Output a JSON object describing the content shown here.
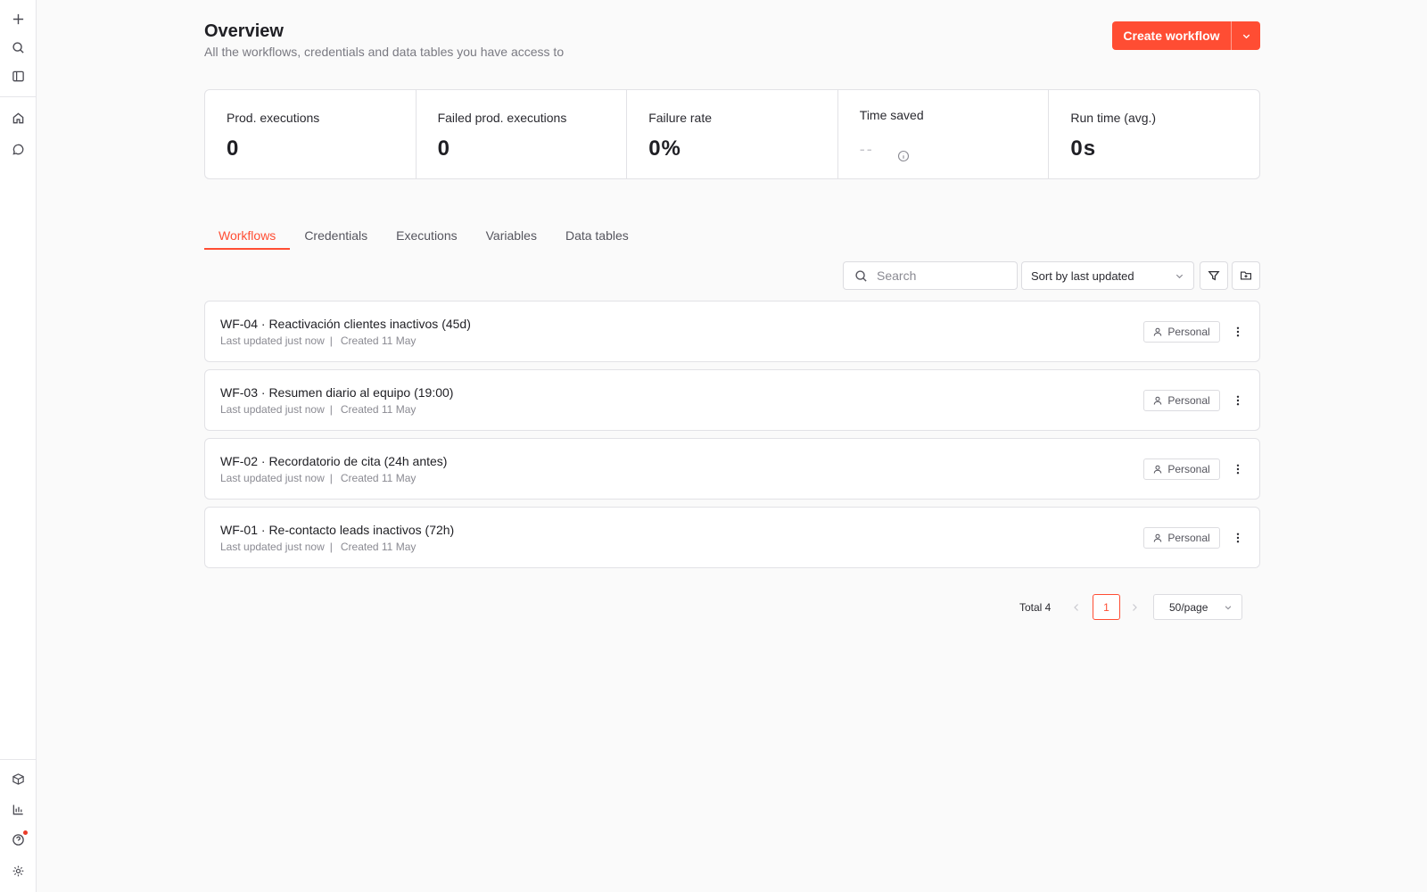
{
  "header": {
    "title": "Overview",
    "subtitle": "All the workflows, credentials and data tables you have access to",
    "create_label": "Create workflow"
  },
  "sidebar": {
    "top_icons": [
      "plus-icon",
      "search-icon",
      "panel-toggle-icon"
    ],
    "nav_icons": [
      "home-icon",
      "chat-icon"
    ],
    "bottom_icons": [
      "cube-icon",
      "chart-icon",
      "help-icon",
      "settings-icon"
    ]
  },
  "stats": [
    {
      "label": "Prod. executions",
      "value": "0"
    },
    {
      "label": "Failed prod. executions",
      "value": "0"
    },
    {
      "label": "Failure rate",
      "value": "0%"
    },
    {
      "label": "Time saved",
      "value": "--"
    },
    {
      "label": "Run time (avg.)",
      "value": "0s"
    }
  ],
  "tabs": [
    "Workflows",
    "Credentials",
    "Executions",
    "Variables",
    "Data tables"
  ],
  "active_tab": "Workflows",
  "toolbar": {
    "search_placeholder": "Search",
    "sort_label": "Sort by last updated"
  },
  "workflows": [
    {
      "name": "WF-04 · Reactivación clientes inactivos (45d)",
      "updated": "Last updated just now",
      "created": "Created 11 May",
      "owner": "Personal"
    },
    {
      "name": "WF-03 · Resumen diario al equipo (19:00)",
      "updated": "Last updated just now",
      "created": "Created 11 May",
      "owner": "Personal"
    },
    {
      "name": "WF-02 · Recordatorio de cita (24h antes)",
      "updated": "Last updated just now",
      "created": "Created 11 May",
      "owner": "Personal"
    },
    {
      "name": "WF-01 · Re-contacto leads inactivos (72h)",
      "updated": "Last updated just now",
      "created": "Created 11 May",
      "owner": "Personal"
    }
  ],
  "pagination": {
    "total_label": "Total 4",
    "current_page": "1",
    "per_page": "50/page"
  },
  "colors": {
    "accent": "#ff4d33",
    "notification": "#ea3c2a"
  }
}
